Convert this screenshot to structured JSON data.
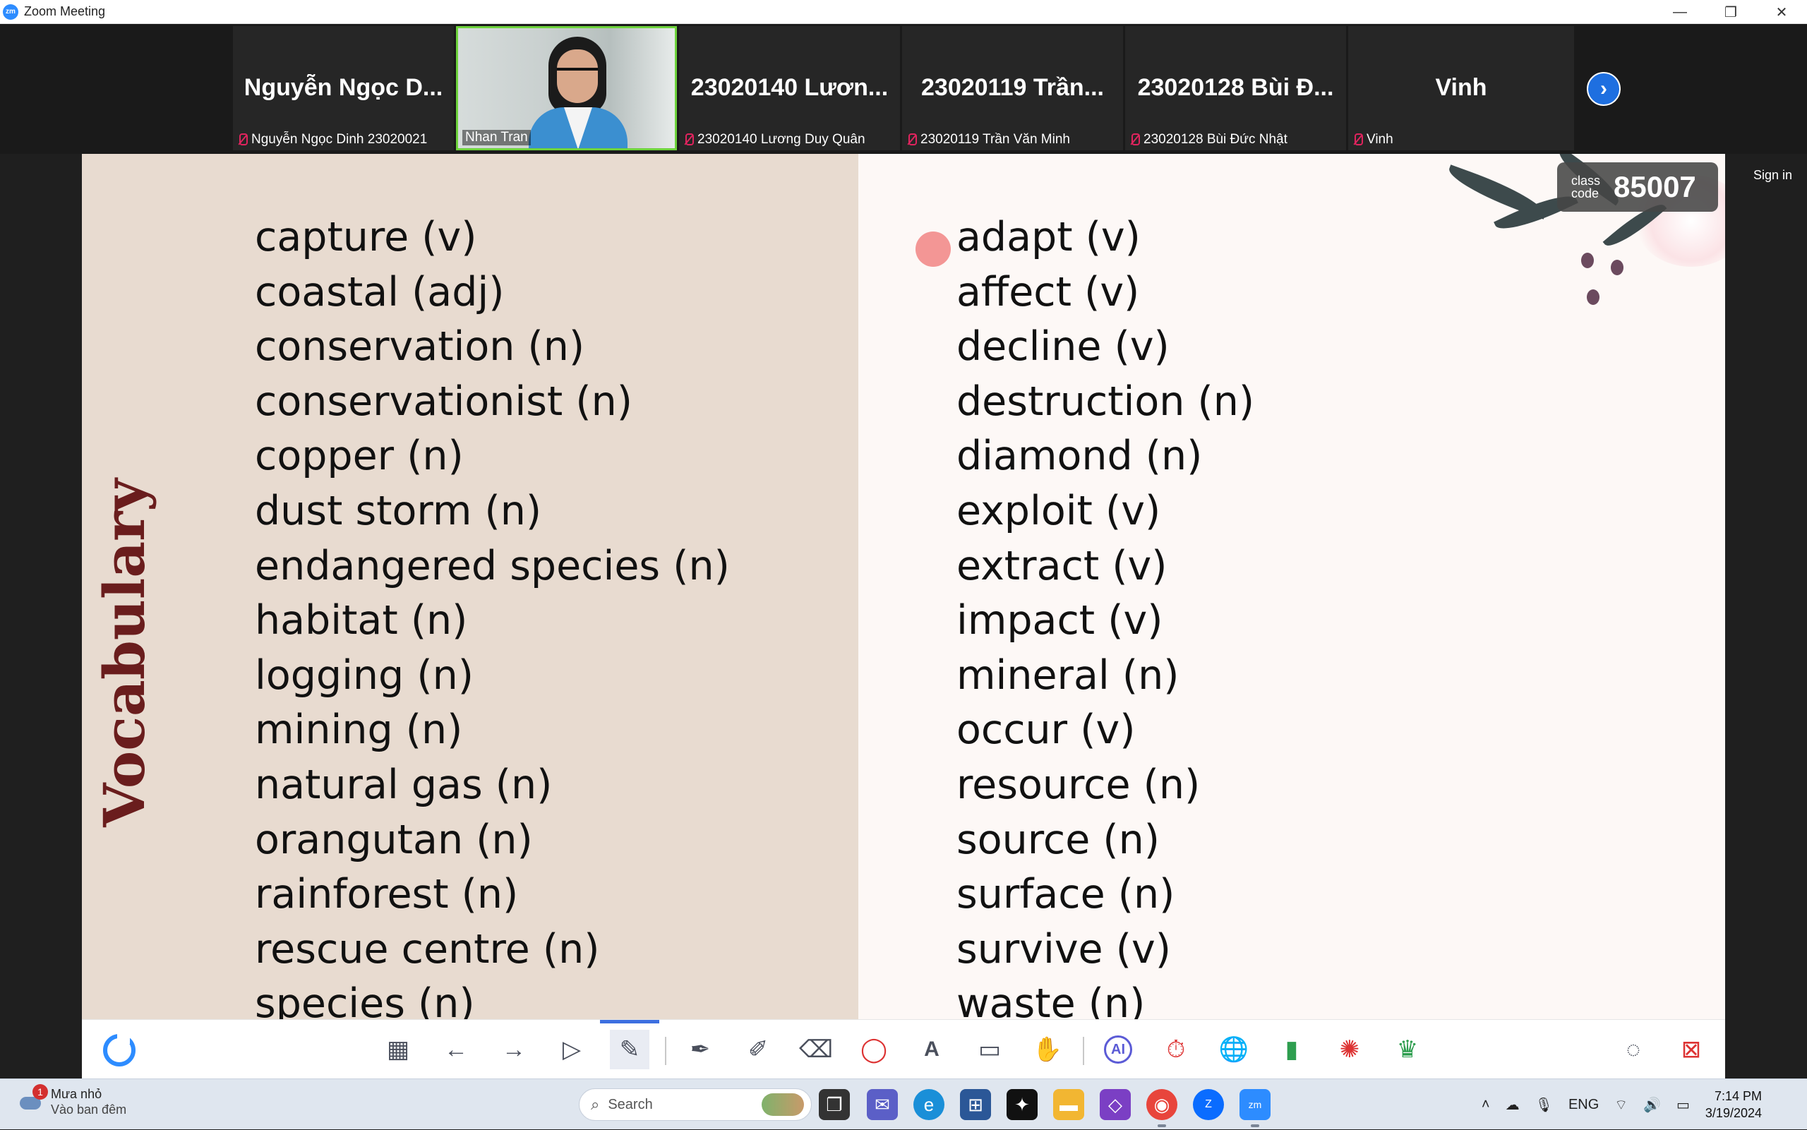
{
  "window": {
    "app_icon_text": "zm",
    "title": "Zoom Meeting",
    "minimize": "—",
    "restore": "❐",
    "close": "✕"
  },
  "participants": [
    {
      "display": "Nguyễn Ngọc D...",
      "label": "Nguyễn Ngọc Dinh 23020021",
      "muted": true
    },
    {
      "display": "",
      "label": "Nhan Tran",
      "muted": false,
      "video": true
    },
    {
      "display": "23020140 Lươn...",
      "label": "23020140 Lương Duy Quân",
      "muted": true
    },
    {
      "display": "23020119 Trần...",
      "label": "23020119 Trần Văn Minh",
      "muted": true
    },
    {
      "display": "23020128 Bùi Đ...",
      "label": "23020128 Bùi Đức Nhật",
      "muted": true
    },
    {
      "display": "Vinh",
      "label": "Vinh",
      "muted": true
    }
  ],
  "next_page": "›",
  "sign_in": "Sign in",
  "slide": {
    "title": "Vocabulary",
    "class_code_label": "class code",
    "class_code_value": "85007",
    "left_words": [
      "capture (v)",
      "coastal (adj)",
      "conservation (n)",
      "conservationist (n)",
      "copper (n)",
      "dust storm (n)",
      "endangered species (n)",
      "habitat (n)",
      "logging (n)",
      "mining (n)",
      "natural gas (n)",
      "orangutan (n)",
      "rainforest (n)",
      "rescue centre (n)",
      "species (n)"
    ],
    "right_words": [
      "adapt (v)",
      "affect (v)",
      "decline (v)",
      "destruction (n)",
      "diamond (n)",
      "exploit (v)",
      "extract (v)",
      "impact (v)",
      "mineral (n)",
      "occur (v)",
      "resource (n)",
      "source (n)",
      "surface (n)",
      "survive (v)",
      "waste (n)"
    ]
  },
  "toolbar": {
    "tools": [
      "grid-icon",
      "back-arrow-icon",
      "forward-arrow-icon",
      "select-icon",
      "pen-icon",
      "highlighter-icon",
      "marker-icon",
      "eraser-icon",
      "shapes-icon",
      "text-icon",
      "sticky-icon",
      "hand-icon",
      "ai-icon",
      "timer-icon",
      "web-icon",
      "chart-icon",
      "wheel-icon",
      "trophy-icon"
    ],
    "ai_text": "AI",
    "text_tool": "A"
  },
  "taskbar": {
    "weather_title": "Mưa nhỏ",
    "weather_sub": "Vào ban đêm",
    "weather_badge": "1",
    "search_placeholder": "Search",
    "language": "ENG",
    "time": "7:14 PM",
    "date": "3/19/2024"
  }
}
